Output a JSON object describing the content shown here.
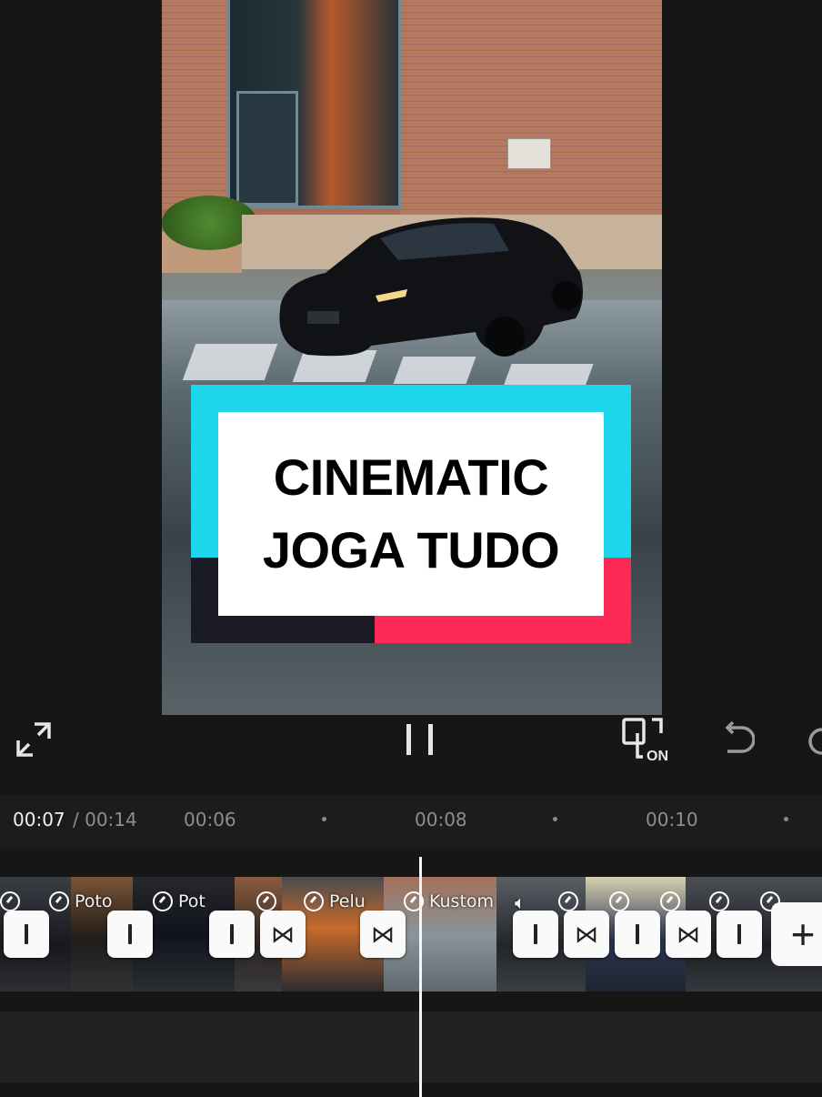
{
  "title_card": {
    "line1": "CINEMATIC",
    "line2": "JOGA TUDO"
  },
  "controls": {
    "fullscreen_icon": "fullscreen-icon",
    "pause_icon": "pause-icon",
    "preview_toggle_icon": "preview-on-icon",
    "preview_toggle_label": "ON",
    "undo_icon": "undo-icon",
    "redo_icon": "redo-icon"
  },
  "timeline": {
    "current_time": "00:07",
    "total_time": "/ 00:14",
    "ticks": [
      "00:06",
      "00:08",
      "00:10"
    ]
  },
  "clips": [
    {
      "label": ""
    },
    {
      "label": "Poto"
    },
    {
      "label": "Pot"
    },
    {
      "label": ""
    },
    {
      "label": "Pelu"
    },
    {
      "label": "Kustom"
    }
  ],
  "add_label": "+",
  "colors": {
    "cyan": "#1ed6ec",
    "pink": "#fe2a56",
    "dark": "#1b1b25"
  }
}
